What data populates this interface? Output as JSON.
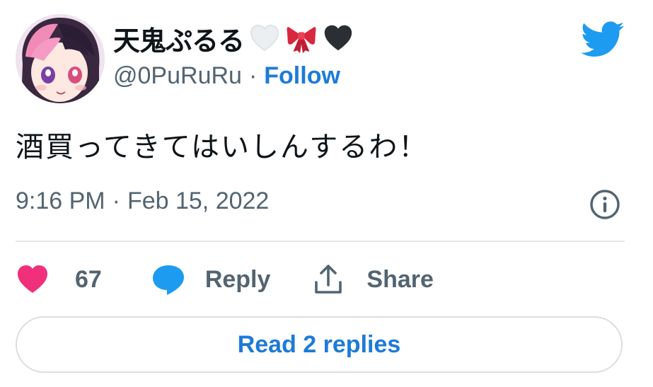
{
  "author": {
    "display_name": "天鬼ぷるる",
    "name_emojis": [
      "white-heart-icon",
      "red-ribbon-icon",
      "black-heart-icon"
    ],
    "handle": "@0PuRuRu",
    "separator": "·",
    "follow_label": "Follow"
  },
  "tweet": {
    "text": "酒買ってきてはいしんするわ！",
    "time": "9:16 PM",
    "separator": "·",
    "date": "Feb 15, 2022"
  },
  "actions": {
    "like_count": "67",
    "reply_label": "Reply",
    "share_label": "Share"
  },
  "read_replies_label": "Read 2 replies",
  "colors": {
    "twitter_blue": "#1d9bf0",
    "link_blue": "#1d7bd8",
    "like_pink": "#f0307a",
    "muted_gray": "#536471",
    "text_dark": "#0f1419",
    "divider": "#e3e7ea"
  }
}
